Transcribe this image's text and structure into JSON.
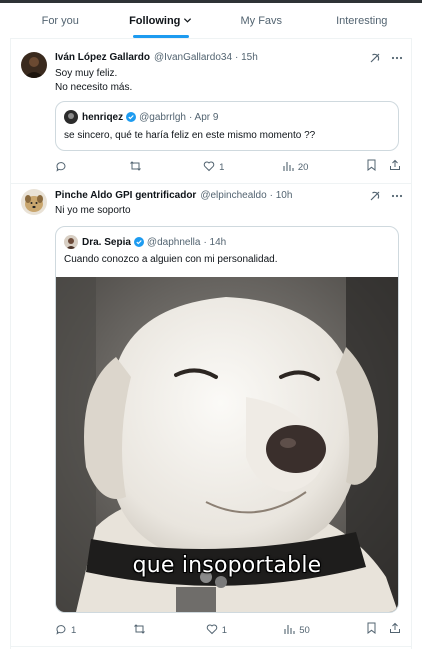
{
  "tabs": [
    {
      "label": "For you"
    },
    {
      "label": "Following"
    },
    {
      "label": "My Favs"
    },
    {
      "label": "Interesting"
    }
  ],
  "tweets": [
    {
      "name": "Iván López Gallardo",
      "handle": "@IvanGallardo34",
      "time": "· 15h",
      "text_lines": [
        "Soy muy feliz.",
        "No necesito más."
      ],
      "quote": {
        "name": "henriqez",
        "handle": "@gabrrlgh",
        "time": "· Apr 9",
        "text": "se sincero, qué te haría feliz en este mismo momento ??"
      },
      "stats": {
        "replies": "",
        "retweets": "",
        "likes": "1",
        "views": "20"
      }
    },
    {
      "name": "Pinche Aldo GPI gentrificador",
      "handle": "@elpinchealdo",
      "time": "· 10h",
      "text_lines": [
        "Ni yo me soporto"
      ],
      "quote": {
        "name": "Dra. Sepia",
        "handle": "@daphnella",
        "time": "· 14h",
        "text": "Cuando conozco a alguien con mi personalidad.",
        "image_caption": "que insoportable"
      },
      "stats": {
        "replies": "1",
        "retweets": "",
        "likes": "1",
        "views": "50"
      }
    }
  ],
  "colors": {
    "accent": "#1d9bf0",
    "muted": "#536471",
    "border": "#cfd9de"
  }
}
